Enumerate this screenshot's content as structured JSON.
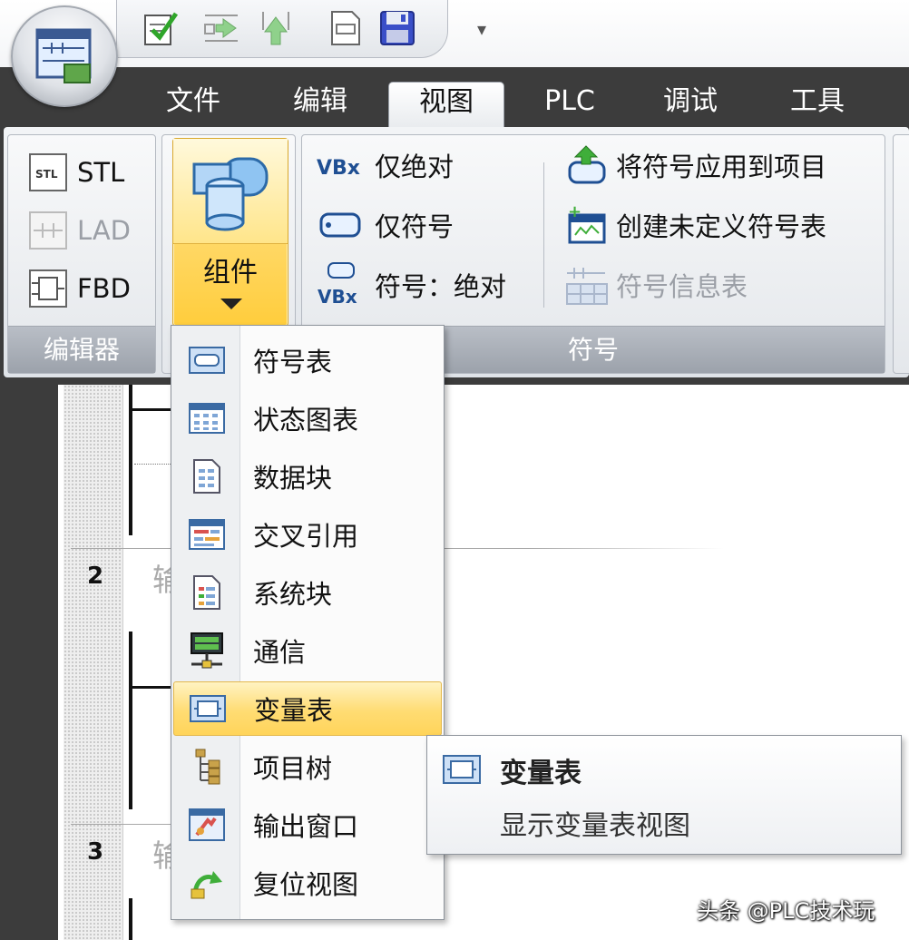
{
  "menu_tabs": [
    {
      "label": "文件"
    },
    {
      "label": "编辑"
    },
    {
      "label": "视图"
    },
    {
      "label": "PLC"
    },
    {
      "label": "调试"
    },
    {
      "label": "工具"
    }
  ],
  "active_tab": "视图",
  "qat_more": "▾",
  "editor_group": {
    "label": "编辑器",
    "stl": "STL",
    "lad": "LAD",
    "fbd": "FBD"
  },
  "components": {
    "label": "组件"
  },
  "symbol_group": {
    "label": "符号",
    "absolute_only": "仅绝对",
    "symbol_only": "仅符号",
    "symbol_absolute": "符号：绝对",
    "apply_symbols": "将符号应用到项目",
    "create_undefined": "创建未定义符号表",
    "symbol_info": "符号信息表",
    "icon_vbx": "VBx"
  },
  "dropdown_items": [
    {
      "label": "符号表",
      "icon": "symbol-table-icon"
    },
    {
      "label": "状态图表",
      "icon": "status-chart-icon"
    },
    {
      "label": "数据块",
      "icon": "data-block-icon"
    },
    {
      "label": "交叉引用",
      "icon": "cross-reference-icon"
    },
    {
      "label": "系统块",
      "icon": "system-block-icon"
    },
    {
      "label": "通信",
      "icon": "communication-icon"
    },
    {
      "label": "变量表",
      "icon": "variable-table-icon"
    },
    {
      "label": "项目树",
      "icon": "project-tree-icon"
    },
    {
      "label": "输出窗口",
      "icon": "output-window-icon"
    },
    {
      "label": "复位视图",
      "icon": "reset-view-icon"
    }
  ],
  "hovered_item": "变量表",
  "submenu": {
    "title": "变量表",
    "description": "显示变量表视图"
  },
  "editor": {
    "rung2_number": "2",
    "rung2_label": "输",
    "rung3_number": "3",
    "rung3_label": "输"
  },
  "watermark": "头条 @PLC技术玩",
  "colors": {
    "ribbon_dark": "#3c3c3c",
    "highlight": "#ffd866",
    "group_label": "#9ca2ab"
  }
}
